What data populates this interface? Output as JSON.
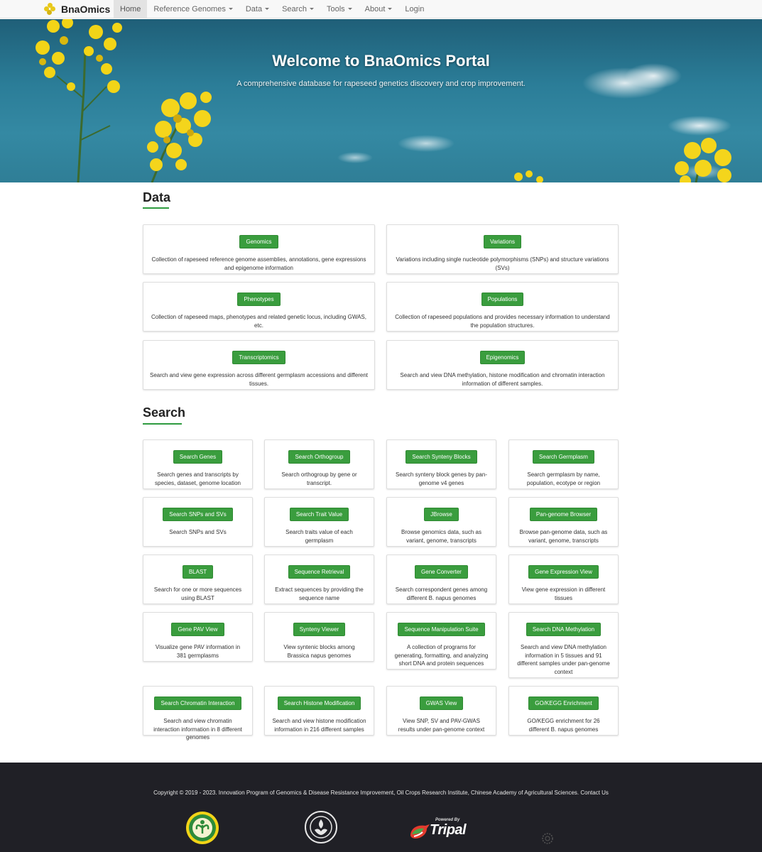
{
  "navbar": {
    "brand": "BnaOmics",
    "items": [
      {
        "label": "Home",
        "active": true,
        "dropdown": false
      },
      {
        "label": "Reference Genomes",
        "active": false,
        "dropdown": true
      },
      {
        "label": "Data",
        "active": false,
        "dropdown": true
      },
      {
        "label": "Search",
        "active": false,
        "dropdown": true
      },
      {
        "label": "Tools",
        "active": false,
        "dropdown": true
      },
      {
        "label": "About",
        "active": false,
        "dropdown": true
      },
      {
        "label": "Login",
        "active": false,
        "dropdown": false
      }
    ]
  },
  "hero": {
    "title": "Welcome to BnaOmics Portal",
    "subtitle": "A comprehensive database for rapeseed genetics discovery and crop improvement."
  },
  "data_section": {
    "title": "Data",
    "cards": [
      {
        "button": "Genomics",
        "desc": "Collection of rapeseed reference genome assemblies, annotations, gene expressions and epigenome information"
      },
      {
        "button": "Variations",
        "desc": "Variations including single nucleotide polymorphisms (SNPs) and structure variations (SVs)"
      },
      {
        "button": "Phenotypes",
        "desc": "Collection of rapeseed maps, phenotypes and related genetic locus, including GWAS, etc."
      },
      {
        "button": "Populations",
        "desc": "Collection of rapeseed populations and provides necessary information to understand the population structures."
      },
      {
        "button": "Transcriptomics",
        "desc": "Search and view gene expression across different germplasm accessions and different tissues."
      },
      {
        "button": "Epigenomics",
        "desc": "Search and view DNA methylation, histone modification and chromatin interaction information of different samples."
      }
    ]
  },
  "search_section": {
    "title": "Search",
    "cards": [
      {
        "button": "Search Genes",
        "desc": "Search genes and transcripts by species, dataset, genome location"
      },
      {
        "button": "Search Orthogroup",
        "desc": "Search orthogroup by gene or transcript."
      },
      {
        "button": "Search Synteny Blocks",
        "desc": "Search synteny block genes by pan-genome v4 genes"
      },
      {
        "button": "Search Germplasm",
        "desc": "Search germplasm by name, population, ecotype or region"
      },
      {
        "button": "Search SNPs and SVs",
        "desc": "Search SNPs and SVs"
      },
      {
        "button": "Search Trait Value",
        "desc": "Search traits value of each germplasm"
      },
      {
        "button": "JBrowse",
        "desc": "Browse genomics data, such as variant, genome, transcripts"
      },
      {
        "button": "Pan-genome Browser",
        "desc": "Browse pan-genome data, such as variant, genome, transcripts"
      },
      {
        "button": "BLAST",
        "desc": "Search for one or more sequences using BLAST"
      },
      {
        "button": "Sequence Retrieval",
        "desc": "Extract sequences by providing the sequence name"
      },
      {
        "button": "Gene Converter",
        "desc": "Search correspondent genes among different B. napus genomes"
      },
      {
        "button": "Gene Expression View",
        "desc": "View gene expression in different tissues"
      },
      {
        "button": "Gene PAV View",
        "desc": "Visualize gene PAV information in 381 germplasms"
      },
      {
        "button": "Synteny Viewer",
        "desc": "View syntenic blocks among Brassica napus genomes"
      },
      {
        "button": "Sequence Manipulation Suite",
        "desc": "A collection of programs for generating, formatting, and analyzing short DNA and protein sequences"
      },
      {
        "button": "Search DNA Methylation",
        "desc": "Search and view DNA methylation information in 5 tissues and 91 different samples under pan-genome context"
      },
      {
        "button": "Search Chromatin Interaction",
        "desc": "Search and view chromatin interaction information in 8 different genomes"
      },
      {
        "button": "Search Histone Modification",
        "desc": "Search and view histone modification information in 216 different samples"
      },
      {
        "button": "GWAS View",
        "desc": "View SNP, SV and PAV-GWAS results under pan-genome context"
      },
      {
        "button": "GO/KEGG Enrichment",
        "desc": "GO/KEGG enrichment for 26 different B. napus genomes"
      }
    ]
  },
  "footer": {
    "copyright": "Copyright © 2019 - 2023. Innovation Program of Genomics & Disease Resistance Improvement, Oil Crops Research Institute, Chinese Academy of Agricultural Sciences. Contact Us",
    "tripal_powered": "Powered By",
    "tripal_name": "Tripal",
    "logos": [
      "institute-emblem",
      "caas-emblem",
      "tripal-logo",
      "small-emblem"
    ]
  },
  "colors": {
    "accent_green": "#3a9d3e",
    "footer_bg": "#202026",
    "hero_sky": "#2b7d98",
    "flower_yellow": "#f2d417"
  }
}
